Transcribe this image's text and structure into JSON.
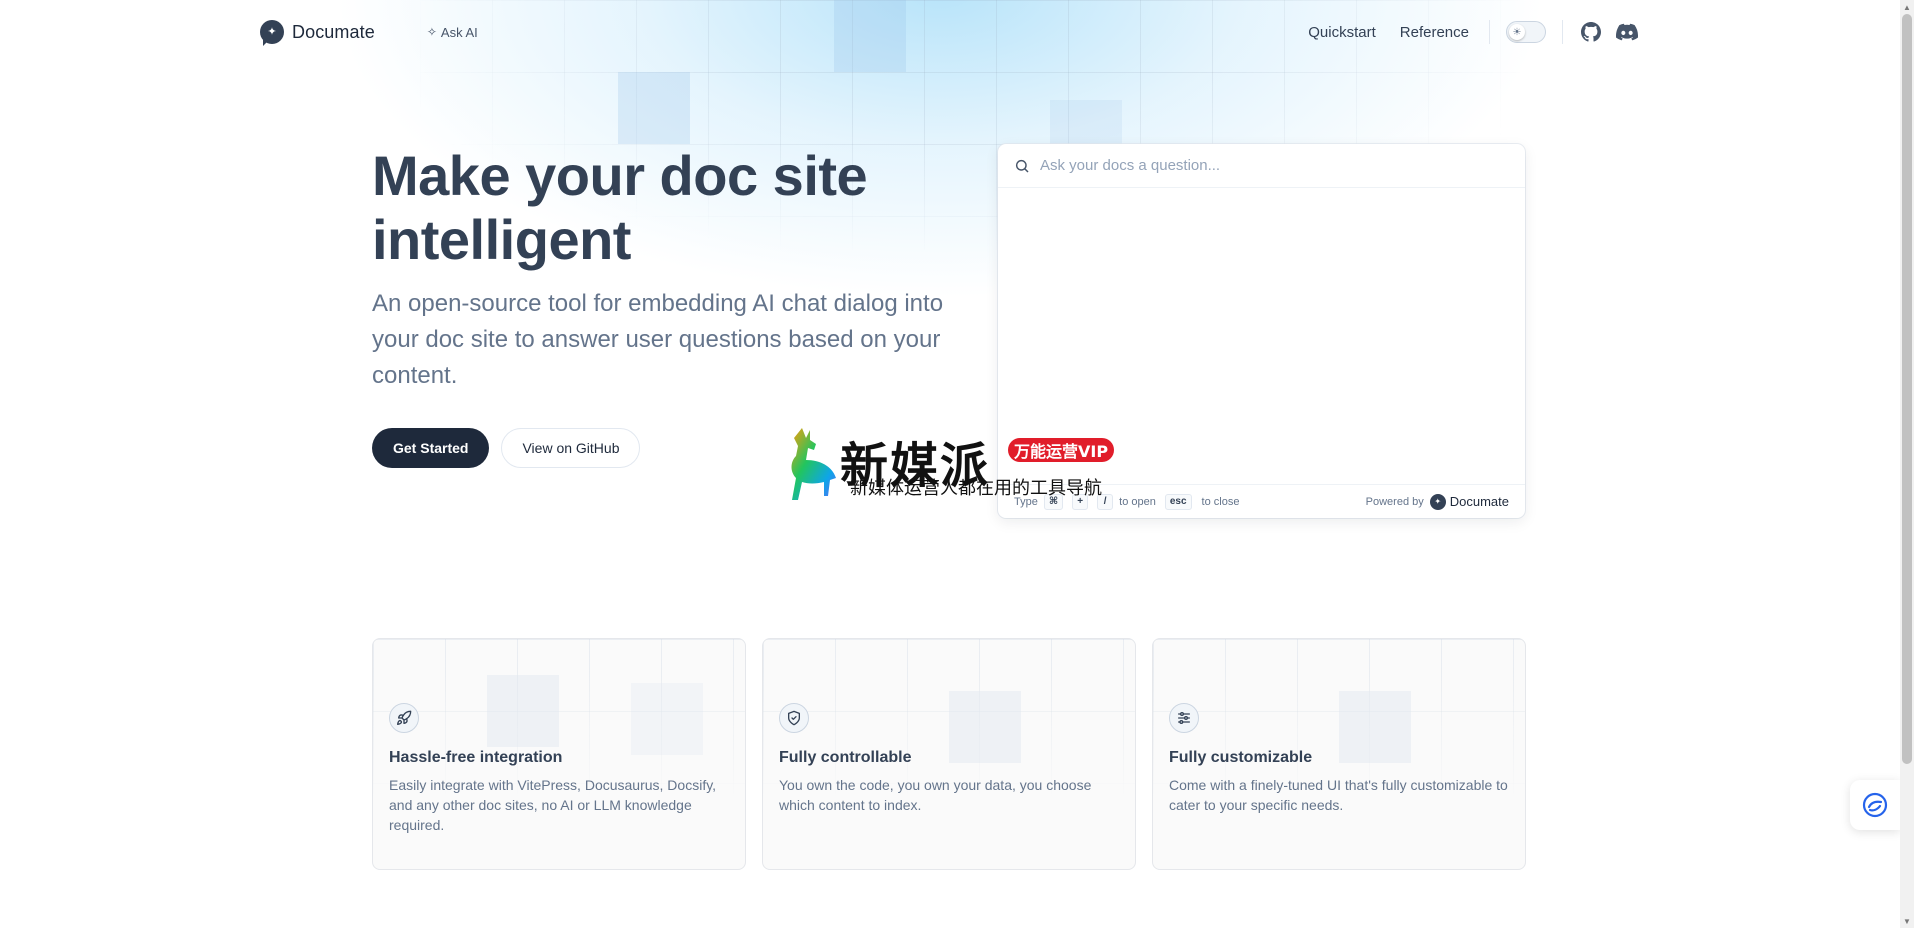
{
  "header": {
    "brand_name": "Documate",
    "ask_ai_label": "Ask AI",
    "nav": [
      {
        "label": "Quickstart"
      },
      {
        "label": "Reference"
      }
    ]
  },
  "hero": {
    "title_line1": "Make your doc site",
    "title_line2": "intelligent",
    "description": "An open-source tool for embedding AI chat dialog into your doc site to answer user questions based on your content.",
    "primary_button": "Get Started",
    "secondary_button": "View on GitHub"
  },
  "dialog": {
    "search_placeholder": "Ask your docs a question...",
    "search_value": "",
    "footer_type": "Type",
    "footer_key_cmd": "⌘",
    "footer_key_plus": "+",
    "footer_key_slash": "/",
    "footer_to_open": "to open",
    "footer_key_esc": "esc",
    "footer_to_close": "to close",
    "powered_by": "Powered by",
    "powered_brand": "Documate"
  },
  "watermark": {
    "title": "新媒派",
    "badge": "万能运营VIP",
    "subtitle": "新媒体运营人都在用的工具导航"
  },
  "features": [
    {
      "icon": "rocket-icon",
      "title": "Hassle-free integration",
      "description": "Easily integrate with VitePress, Docusaurus, Docsify, and any other doc sites, no AI or LLM knowledge required."
    },
    {
      "icon": "shield-check-icon",
      "title": "Fully controllable",
      "description": "You own the code, you own your data, you choose which content to index."
    },
    {
      "icon": "sliders-icon",
      "title": "Fully customizable",
      "description": "Come with a finely-tuned UI that's fully customizable to cater to your specific needs."
    }
  ],
  "colors": {
    "primary_dark": "#1e293b",
    "text": "#334155",
    "muted": "#64748b",
    "accent_glow": "#7dcdf5",
    "badge_red": "#e11d2a"
  }
}
